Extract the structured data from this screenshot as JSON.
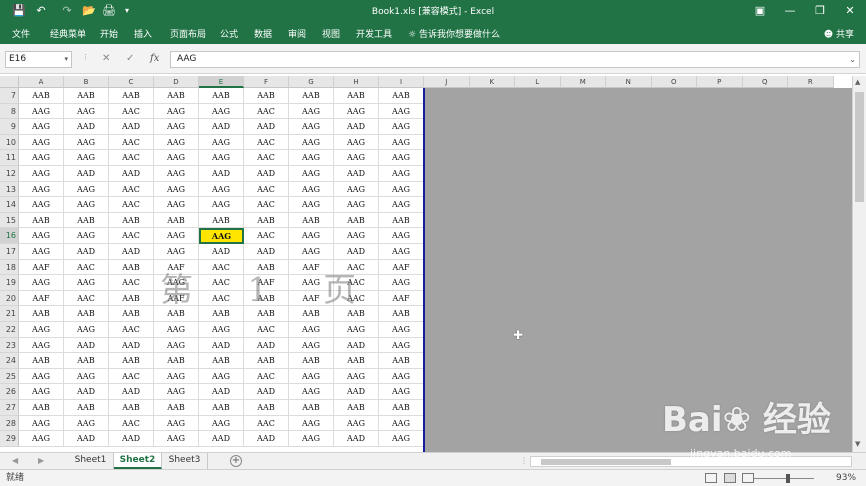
{
  "titlebar": {
    "title": "Book1.xls  [兼容模式]  -  Excel",
    "save_icon": "save-icon",
    "undo_icon": "undo-icon",
    "redo_icon": "redo-icon",
    "open_icon": "open-icon",
    "print_icon": "print-icon",
    "accent": "#217346"
  },
  "menubar": {
    "items": [
      "文件",
      "经典菜单",
      "开始",
      "插入",
      "页面布局",
      "公式",
      "数据",
      "审阅",
      "视图",
      "开发工具"
    ],
    "tell_me": "告诉我你想要做什么",
    "share": "共享"
  },
  "formula_bar": {
    "name_box": "E16",
    "cancel": "✕",
    "enter": "✓",
    "fx": "fx",
    "value": "AAG"
  },
  "grid": {
    "columns": [
      "A",
      "B",
      "C",
      "D",
      "E",
      "F",
      "G",
      "H",
      "I",
      "J",
      "K",
      "L",
      "M",
      "N",
      "O",
      "P",
      "Q",
      "R"
    ],
    "selected_column": "E",
    "row_numbers": [
      "7",
      "8",
      "9",
      "10",
      "11",
      "12",
      "13",
      "14",
      "15",
      "16",
      "17",
      "18",
      "19",
      "20",
      "21",
      "22",
      "23",
      "24",
      "25",
      "26",
      "27",
      "28",
      "29"
    ],
    "selected_row": "16",
    "rows": [
      [
        "AAB",
        "AAB",
        "AAB",
        "AAB",
        "AAB",
        "AAB",
        "AAB",
        "AAB",
        "AAB"
      ],
      [
        "AAG",
        "AAG",
        "AAC",
        "AAG",
        "AAG",
        "AAC",
        "AAG",
        "AAG",
        "AAG"
      ],
      [
        "AAG",
        "AAD",
        "AAD",
        "AAG",
        "AAD",
        "AAD",
        "AAG",
        "AAD",
        "AAG"
      ],
      [
        "AAG",
        "AAG",
        "AAC",
        "AAG",
        "AAG",
        "AAC",
        "AAG",
        "AAG",
        "AAG"
      ],
      [
        "AAG",
        "AAG",
        "AAC",
        "AAG",
        "AAG",
        "AAC",
        "AAG",
        "AAG",
        "AAG"
      ],
      [
        "AAG",
        "AAD",
        "AAD",
        "AAG",
        "AAD",
        "AAD",
        "AAG",
        "AAD",
        "AAG"
      ],
      [
        "AAG",
        "AAG",
        "AAC",
        "AAG",
        "AAG",
        "AAC",
        "AAG",
        "AAG",
        "AAG"
      ],
      [
        "AAG",
        "AAG",
        "AAC",
        "AAG",
        "AAG",
        "AAC",
        "AAG",
        "AAG",
        "AAG"
      ],
      [
        "AAB",
        "AAB",
        "AAB",
        "AAB",
        "AAB",
        "AAB",
        "AAB",
        "AAB",
        "AAB"
      ],
      [
        "AAG",
        "AAG",
        "AAC",
        "AAG",
        "AAG",
        "AAC",
        "AAG",
        "AAG",
        "AAG"
      ],
      [
        "AAG",
        "AAD",
        "AAD",
        "AAG",
        "AAD",
        "AAD",
        "AAG",
        "AAD",
        "AAG"
      ],
      [
        "AAF",
        "AAC",
        "AAB",
        "AAF",
        "AAC",
        "AAB",
        "AAF",
        "AAC",
        "AAF"
      ],
      [
        "AAG",
        "AAG",
        "AAC",
        "AAG",
        "AAC",
        "AAF",
        "AAG",
        "AAC",
        "AAG"
      ],
      [
        "AAF",
        "AAC",
        "AAB",
        "AAF",
        "AAC",
        "AAB",
        "AAF",
        "AAC",
        "AAF"
      ],
      [
        "AAB",
        "AAB",
        "AAB",
        "AAB",
        "AAB",
        "AAB",
        "AAB",
        "AAB",
        "AAB"
      ],
      [
        "AAG",
        "AAG",
        "AAC",
        "AAG",
        "AAG",
        "AAC",
        "AAG",
        "AAG",
        "AAG"
      ],
      [
        "AAG",
        "AAD",
        "AAD",
        "AAG",
        "AAD",
        "AAD",
        "AAG",
        "AAD",
        "AAG"
      ],
      [
        "AAB",
        "AAB",
        "AAB",
        "AAB",
        "AAB",
        "AAB",
        "AAB",
        "AAB",
        "AAB"
      ],
      [
        "AAG",
        "AAG",
        "AAC",
        "AAG",
        "AAG",
        "AAC",
        "AAG",
        "AAG",
        "AAG"
      ],
      [
        "AAG",
        "AAD",
        "AAD",
        "AAG",
        "AAD",
        "AAD",
        "AAG",
        "AAD",
        "AAG"
      ],
      [
        "AAB",
        "AAB",
        "AAB",
        "AAB",
        "AAB",
        "AAB",
        "AAB",
        "AAB",
        "AAB"
      ],
      [
        "AAG",
        "AAG",
        "AAC",
        "AAG",
        "AAG",
        "AAC",
        "AAG",
        "AAG",
        "AAG"
      ],
      [
        "AAG",
        "AAD",
        "AAD",
        "AAG",
        "AAD",
        "AAD",
        "AAG",
        "AAD",
        "AAG"
      ]
    ],
    "active_cell": "AAG",
    "page_watermark": "第 1 页",
    "active_color": "#ffe500"
  },
  "sheets": {
    "tabs": [
      "Sheet1",
      "Sheet2",
      "Sheet3"
    ],
    "active": "Sheet2",
    "add": "+"
  },
  "statusbar": {
    "status": "就绪",
    "zoom": "93%"
  },
  "watermark_logo": {
    "brand": "Bai 经验",
    "url": "jingyan.baidu.com"
  }
}
